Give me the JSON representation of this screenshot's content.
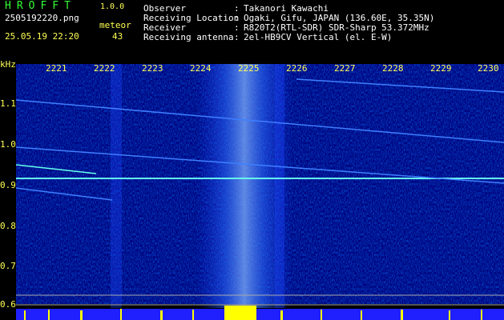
{
  "header": {
    "app_title": "HROFFT",
    "app_version": "1.0.0",
    "file_name": "2505192220.png",
    "meteor_label": "meteor",
    "meteor_count": "43",
    "datetime": "25.05.19 22:20"
  },
  "info": [
    {
      "key": "Observer",
      "value": "Takanori Kawachi"
    },
    {
      "key": "Receiving Location",
      "value": "Ogaki, Gifu, JAPAN (136.60E, 35.35N)"
    },
    {
      "key": "Receiver",
      "value": "R820T2(RTL-SDR) SDR-Sharp 53.372MHz"
    },
    {
      "key": "Receiving antenna",
      "value": "2el-HB9CV Vertical (el. E-W)"
    }
  ],
  "axis": {
    "y_unit": "kHz",
    "x_ticks": [
      "2221",
      "2222",
      "2223",
      "2224",
      "2225",
      "2226",
      "2227",
      "2228",
      "2229",
      "2230"
    ],
    "y_ticks": [
      "1.1",
      "1.0",
      "0.9",
      "0.8",
      "0.7",
      "0.6"
    ]
  },
  "colors": {
    "text_green": "#33ff33",
    "text_yellow": "#ffff55",
    "background": "#000000",
    "noise": "#00008a"
  }
}
